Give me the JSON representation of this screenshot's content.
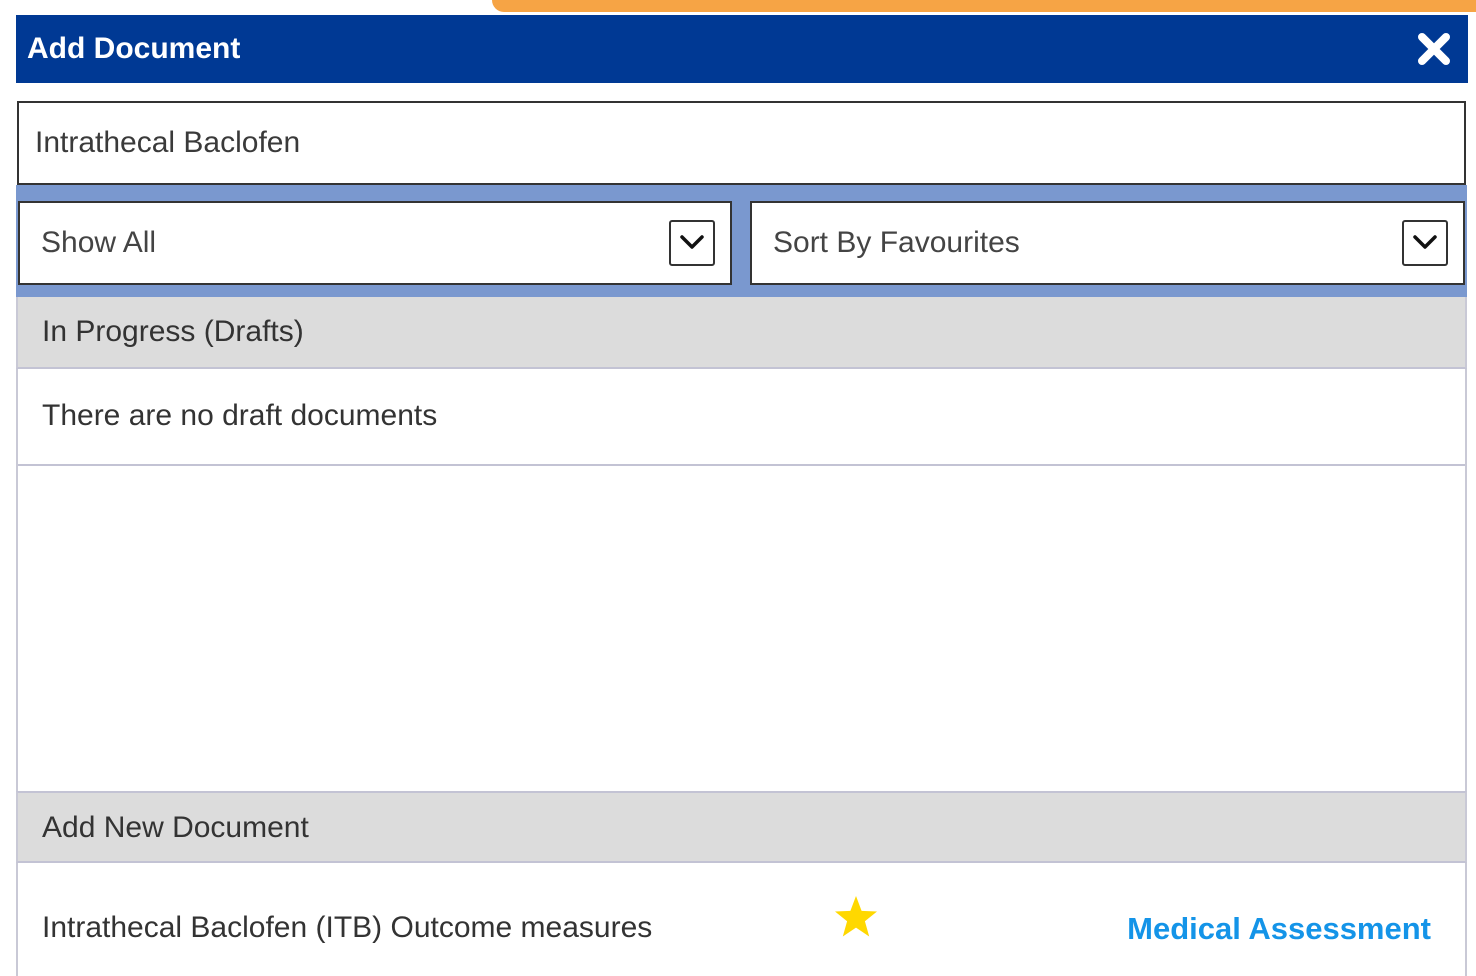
{
  "dialog": {
    "title": "Add Document",
    "close_icon": "close-icon"
  },
  "search": {
    "value": "Intrathecal Baclofen"
  },
  "filters": {
    "show_selected": "Show All",
    "sort_selected": "Sort By Favourites"
  },
  "drafts": {
    "header": "In Progress (Drafts)",
    "empty_message": "There are no draft documents"
  },
  "new_document": {
    "header": "Add New Document",
    "items": [
      {
        "title": "Intrathecal Baclofen (ITB) Outcome measures",
        "favourite": true,
        "category": "Medical Assessment"
      }
    ]
  },
  "colors": {
    "header_blue": "#003994",
    "filter_bar_blue": "#7a98cf",
    "accent_orange": "#f6a445",
    "link_blue": "#1494e8",
    "star_yellow": "#ffd800",
    "section_grey": "#dcdcdc"
  }
}
